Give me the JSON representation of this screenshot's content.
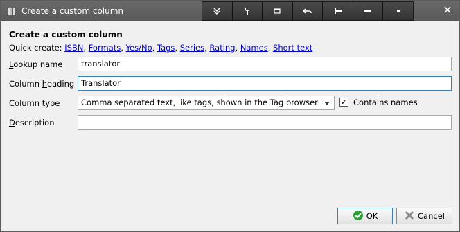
{
  "window": {
    "title": "Create a custom column",
    "close_glyph": "✕"
  },
  "toolbar": {
    "icons": [
      "expand-down-icon",
      "wrench-icon",
      "window-icon",
      "undo-icon",
      "pin-icon",
      "minimize-icon",
      "stop-icon"
    ]
  },
  "dialog": {
    "heading": "Create a custom column",
    "quick_create_label": "Quick create:",
    "quick_links": [
      "ISBN",
      "Formats",
      "Yes/No",
      "Tags",
      "Series",
      "Rating",
      "Names",
      "Short text"
    ]
  },
  "form": {
    "lookup_name": {
      "label_pre": "",
      "label_u": "L",
      "label_post": "ookup name",
      "value": "translator"
    },
    "column_heading": {
      "label_pre": "Column ",
      "label_u": "h",
      "label_post": "eading",
      "value": "Translator"
    },
    "column_type": {
      "label_pre": "",
      "label_u": "C",
      "label_post": "olumn type",
      "value": "Comma separated text, like tags, shown in the Tag browser"
    },
    "contains_names": {
      "label": "Contains names",
      "checked": true,
      "check_glyph": "✓"
    },
    "description": {
      "label_pre": "",
      "label_u": "D",
      "label_post": "escription",
      "value": ""
    }
  },
  "buttons": {
    "ok": {
      "label": "OK",
      "color": "#2e9e3a"
    },
    "cancel": {
      "label": "Cancel",
      "color": "#8a8a8a"
    }
  }
}
